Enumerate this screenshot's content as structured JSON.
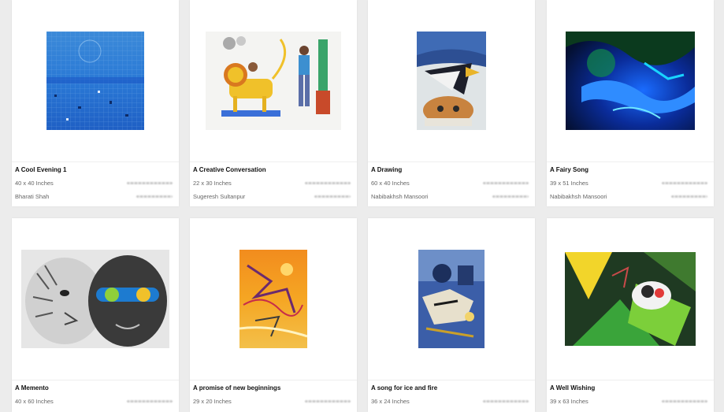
{
  "cards": [
    {
      "title": "A Cool Evening 1",
      "size": "40 x 40 Inches",
      "artist": "Bharati Shah",
      "art": "blue-grid-abstract-painting"
    },
    {
      "title": "A Creative Conversation",
      "size": "22 x 30 Inches",
      "artist": "Sugeresh Sultanpur",
      "art": "lion-and-man-painting"
    },
    {
      "title": "A Drawing",
      "size": "60 x 40 Inches",
      "artist": "Nabibakhsh Mansoori",
      "art": "cat-and-bird-painting"
    },
    {
      "title": "A Fairy Song",
      "size": "39 x 51 Inches",
      "artist": "Nabibakhsh Mansoori",
      "art": "neon-blue-landscape-painting"
    },
    {
      "title": "A Memento",
      "size": "40 x 60 Inches",
      "artist": "",
      "art": "tiger-and-face-drawing"
    },
    {
      "title": "A promise of new beginnings",
      "size": "29 x 20 Inches",
      "artist": "",
      "art": "orange-abstract-painting"
    },
    {
      "title": "A song for ice and fire",
      "size": "36 x 24 Inches",
      "artist": "",
      "art": "blue-abstract-painting"
    },
    {
      "title": "A Well Wishing",
      "size": "39 x 63 Inches",
      "artist": "",
      "art": "green-cat-painting"
    }
  ]
}
